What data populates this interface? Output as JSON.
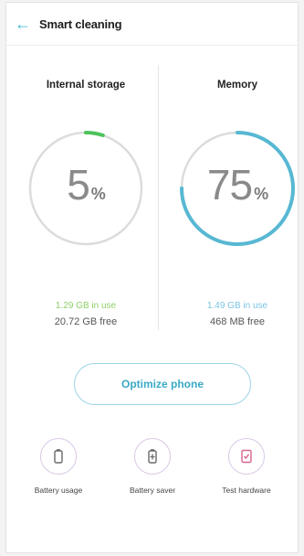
{
  "appbar": {
    "title": "Smart cleaning"
  },
  "storage": {
    "title": "Internal storage",
    "percent": "5",
    "percent_value": 0.05,
    "in_use": "1.29 GB in use",
    "free": "20.72 GB free"
  },
  "memory": {
    "title": "Memory",
    "percent": "75",
    "percent_value": 0.75,
    "in_use": "1.49 GB in use",
    "free": "468 MB free"
  },
  "percent_sign": "%",
  "actions": {
    "optimize": "Optimize phone"
  },
  "tools": [
    {
      "label": "Battery usage",
      "icon": "battery-icon"
    },
    {
      "label": "Battery saver",
      "icon": "battery-saver-icon"
    },
    {
      "label": "Test hardware",
      "icon": "test-hardware-icon"
    }
  ],
  "colors": {
    "accent": "#39b6cf",
    "storage_arc": "#4cc35b",
    "memory_arc": "#58b8d3",
    "track": "#dcdcdc",
    "icon_pink": "#d9648f"
  }
}
